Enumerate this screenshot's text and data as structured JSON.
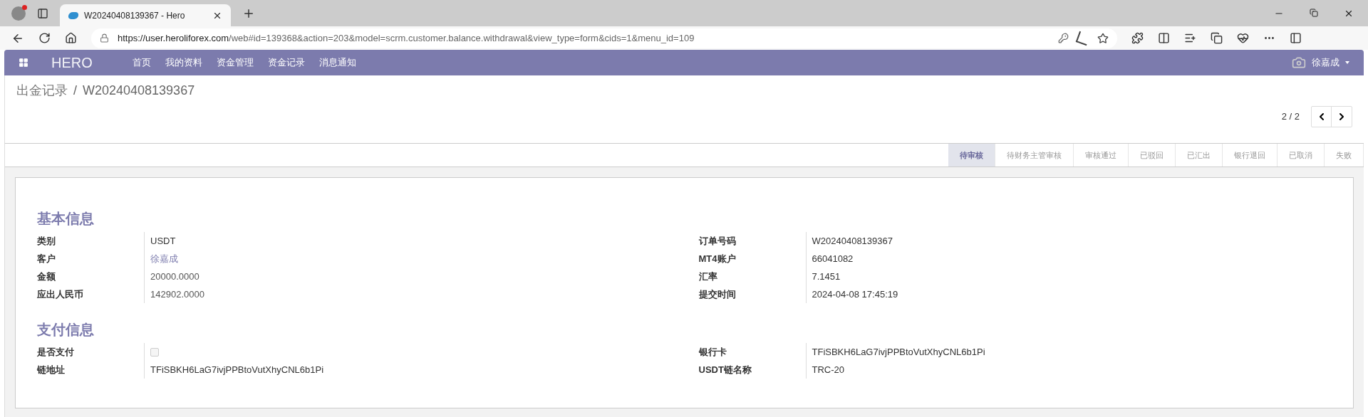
{
  "browser": {
    "tab_title": "W20240408139367 - Hero",
    "url_host": "https://user.heroliforex.com",
    "url_path": "/web#id=139368&action=203&model=scrm.customer.balance.withdrawal&view_type=form&cids=1&menu_id=109"
  },
  "navbar": {
    "brand": "HERO",
    "menu": [
      "首页",
      "我的资料",
      "资金管理",
      "资金记录",
      "消息通知"
    ],
    "user": "徐嘉成"
  },
  "breadcrumb": {
    "parent": "出金记录",
    "separator": "/",
    "current": "W20240408139367"
  },
  "pager": {
    "counter": "2 / 2"
  },
  "stages": [
    {
      "label": "待审核",
      "selected": true
    },
    {
      "label": "待财务主管审核",
      "selected": false
    },
    {
      "label": "审核通过",
      "selected": false
    },
    {
      "label": "已驳回",
      "selected": false
    },
    {
      "label": "已汇出",
      "selected": false
    },
    {
      "label": "银行退回",
      "selected": false
    },
    {
      "label": "已取消",
      "selected": false
    },
    {
      "label": "失败",
      "selected": false
    }
  ],
  "sections": [
    {
      "title": "基本信息",
      "left": [
        {
          "label": "类别",
          "kind": "text",
          "value": "USDT"
        },
        {
          "label": "客户",
          "kind": "link",
          "value": "徐嘉成"
        },
        {
          "label": "金额",
          "kind": "readonly",
          "value": "20000.0000"
        },
        {
          "label": "应出人民币",
          "kind": "readonly",
          "value": "142902.0000"
        }
      ],
      "right": [
        {
          "label": "订单号码",
          "kind": "text",
          "value": "W20240408139367"
        },
        {
          "label": "MT4账户",
          "kind": "text",
          "value": "66041082"
        },
        {
          "label": "汇率",
          "kind": "text",
          "value": "7.1451"
        },
        {
          "label": "提交时间",
          "kind": "text",
          "value": "2024-04-08 17:45:19"
        }
      ]
    },
    {
      "title": "支付信息",
      "left": [
        {
          "label": "是否支付",
          "kind": "checkbox",
          "checked": false
        },
        {
          "label": "链地址",
          "kind": "text",
          "value": "TFiSBKH6LaG7ivjPPBtoVutXhyCNL6b1Pi"
        }
      ],
      "right": [
        {
          "label": "银行卡",
          "kind": "text",
          "value": "TFiSBKH6LaG7ivjPPBtoVutXhyCNL6b1Pi"
        },
        {
          "label": "USDT链名称",
          "kind": "text",
          "value": "TRC-20"
        }
      ]
    }
  ]
}
